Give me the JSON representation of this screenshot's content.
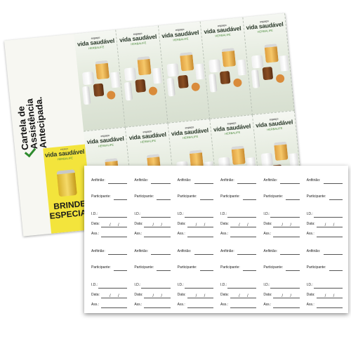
{
  "back_card": {
    "side_title": "Cartela de\nAssistência\nAntecipada.",
    "brand_prefix": "espaço",
    "brand_name": "vida saudável",
    "brand_sub": "HERBALIFE",
    "gift_label": "BRINDE\nESPECIAL",
    "accent_yellow": "#f3e43c",
    "accent_green": "#2e8b2e",
    "ticket_count": 10
  },
  "form": {
    "labels": {
      "host": "Anfitrião:",
      "participant": "Participante:",
      "id": "I.D.:",
      "date": "Data:",
      "signature": "Ass.:"
    }
  }
}
